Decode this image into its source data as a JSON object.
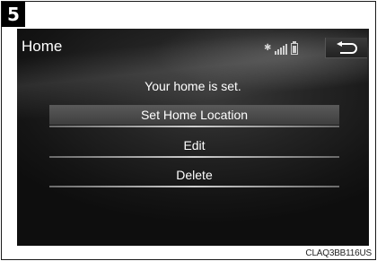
{
  "step_number": "5",
  "screen": {
    "title": "Home",
    "status_icons": [
      "bluetooth-icon",
      "signal-icon",
      "battery-icon"
    ],
    "back_icon": "return-arrow-icon",
    "message": "Your home is set.",
    "buttons": [
      {
        "label": "Set Home Location"
      },
      {
        "label": "Edit"
      },
      {
        "label": "Delete"
      }
    ]
  },
  "caption": "CLAQ3BB116US"
}
